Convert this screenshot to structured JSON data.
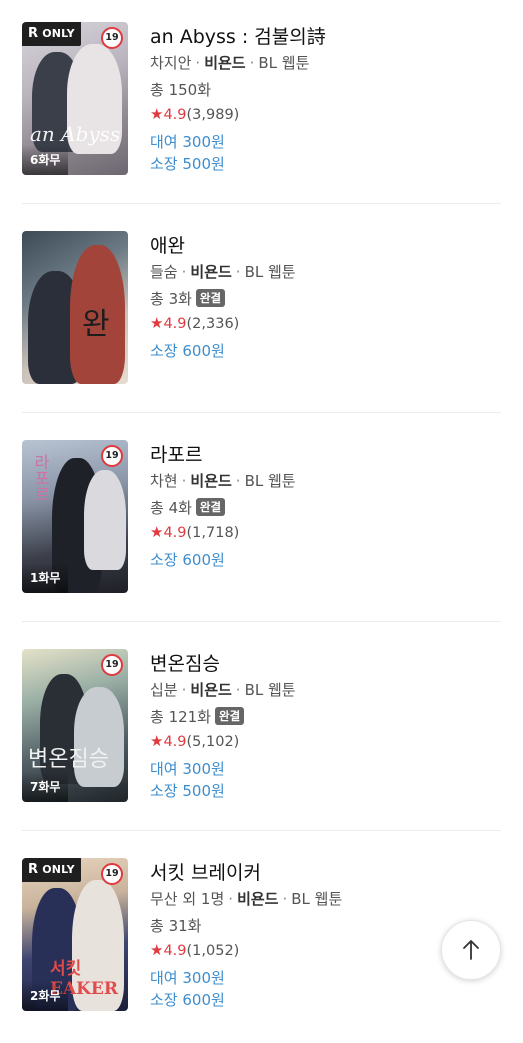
{
  "items": [
    {
      "title": "an Abyss : 검불의詩",
      "author": "차지안",
      "publisher": "비욘드",
      "genre": "BL 웹툰",
      "episodes": "총 150화",
      "completed": "",
      "rating": "4.9",
      "rating_count": "(3,989)",
      "rent": "대여 300원",
      "own": "소장 500원",
      "ronly": "ONLY",
      "ronly_r": "R",
      "age": "19",
      "free": "6화무",
      "cover_text": "an Abyss"
    },
    {
      "title": "애완",
      "author": "들숨",
      "publisher": "비욘드",
      "genre": "BL 웹툰",
      "episodes": "총 3화",
      "completed": "완결",
      "rating": "4.9",
      "rating_count": "(2,336)",
      "rent": "",
      "own": "소장 600원",
      "ronly": "",
      "age": "",
      "free": "",
      "cover_text": "완"
    },
    {
      "title": "라포르",
      "author": "차현",
      "publisher": "비욘드",
      "genre": "BL 웹툰",
      "episodes": "총 4화",
      "completed": "완결",
      "rating": "4.9",
      "rating_count": "(1,718)",
      "rent": "",
      "own": "소장 600원",
      "ronly": "",
      "age": "19",
      "free": "1화무",
      "cover_text": "라포르"
    },
    {
      "title": "변온짐승",
      "author": "십분",
      "publisher": "비욘드",
      "genre": "BL 웹툰",
      "episodes": "총 121화",
      "completed": "완결",
      "rating": "4.9",
      "rating_count": "(5,102)",
      "rent": "대여 300원",
      "own": "소장 500원",
      "ronly": "",
      "age": "19",
      "free": "7화무",
      "cover_text": "변온짐승"
    },
    {
      "title": "서킷 브레이커",
      "author": "무산 외 1명",
      "publisher": "비욘드",
      "genre": "BL 웹툰",
      "episodes": "총 31화",
      "completed": "",
      "rating": "4.9",
      "rating_count": "(1,052)",
      "rent": "대여 300원",
      "own": "소장 600원",
      "ronly": "ONLY",
      "ronly_r": "R",
      "age": "19",
      "free": "2화무",
      "cover_text": "서킷 EAKER"
    }
  ],
  "colors": {
    "price": "#3d8dce",
    "rating": "#e0393e",
    "divider": "#ececec"
  },
  "scroll_top_icon": "arrow-up-icon"
}
